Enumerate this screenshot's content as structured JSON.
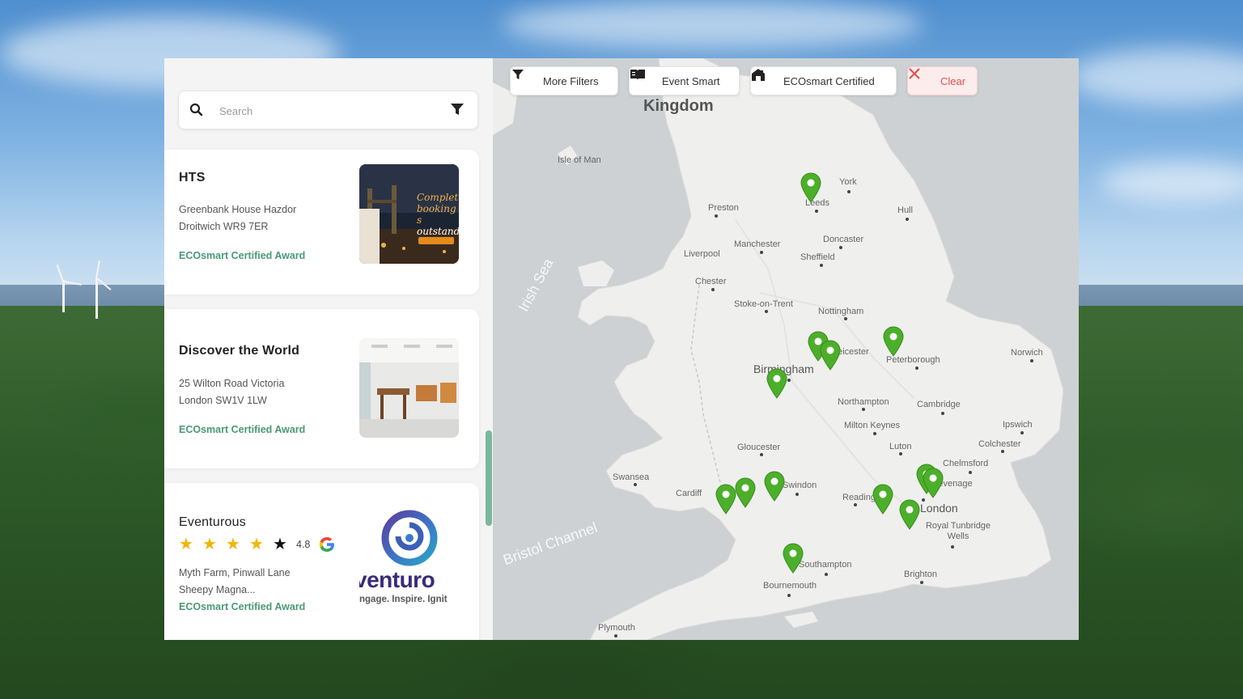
{
  "search": {
    "placeholder": "Search"
  },
  "filters": {
    "more_filters": "More Filters",
    "event_smart": "Event Smart",
    "ecosmart_certified": "ECOsmart Certified",
    "clear": "Clear"
  },
  "listings": [
    {
      "title": "HTS",
      "address_line1": "Greenbank House Hazdor",
      "address_line2": "Droitwich WR9 7ER",
      "award": "ECOsmart Certified Award"
    },
    {
      "title": "Discover the World",
      "address_line1": "25 Wilton Road Victoria",
      "address_line2": "London SW1V 1LW",
      "award": "ECOsmart Certified Award"
    },
    {
      "title": "Eventurous",
      "rating": "4.8",
      "stars_filled": 4,
      "address_line1": "Myth Farm, Pinwall Lane",
      "address_line2": "Sheepy Magna...",
      "award": "ECOsmart Certified Award",
      "logo_text": "venturo",
      "logo_tagline": "ngage. Inspire. Ignit"
    }
  ],
  "hts_image": {
    "line1": "Complet",
    "line2": "booking s",
    "line3": "outstandi"
  },
  "map": {
    "region": "Kingdom",
    "isle": "Isle of Man",
    "irish_sea": "Irish Sea",
    "bristol_channel": "Bristol Channel",
    "cities": {
      "york": "York",
      "preston": "Preston",
      "leeds": "Leeds",
      "hull": "Hull",
      "manchester": "Manchester",
      "doncaster": "Doncaster",
      "liverpool": "Liverpool",
      "sheffield": "Sheffield",
      "chester": "Chester",
      "stoke": "Stoke-on-Trent",
      "nottingham": "Nottingham",
      "leicester": "Leicester",
      "peterborough": "Peterborough",
      "norwich": "Norwich",
      "birmingham": "Birmingham",
      "northampton": "Northampton",
      "cambridge": "Cambridge",
      "milton_keynes": "Milton Keynes",
      "ipswich": "Ipswich",
      "gloucester": "Gloucester",
      "luton": "Luton",
      "colchester": "Colchester",
      "chelmsford": "Chelmsford",
      "swansea": "Swansea",
      "cardiff": "Cardiff",
      "swindon": "Swindon",
      "reading": "Reading",
      "london": "London",
      "stevenage": "Stevenage",
      "tunbridge": "Royal Tunbridge Wells",
      "southampton": "Southampton",
      "bournemouth": "Bournemouth",
      "brighton": "Brighton",
      "plymouth": "Plymouth"
    }
  },
  "colors": {
    "accent": "#4a9a73",
    "pin": "#4caf2a",
    "clear": "#e05252"
  }
}
